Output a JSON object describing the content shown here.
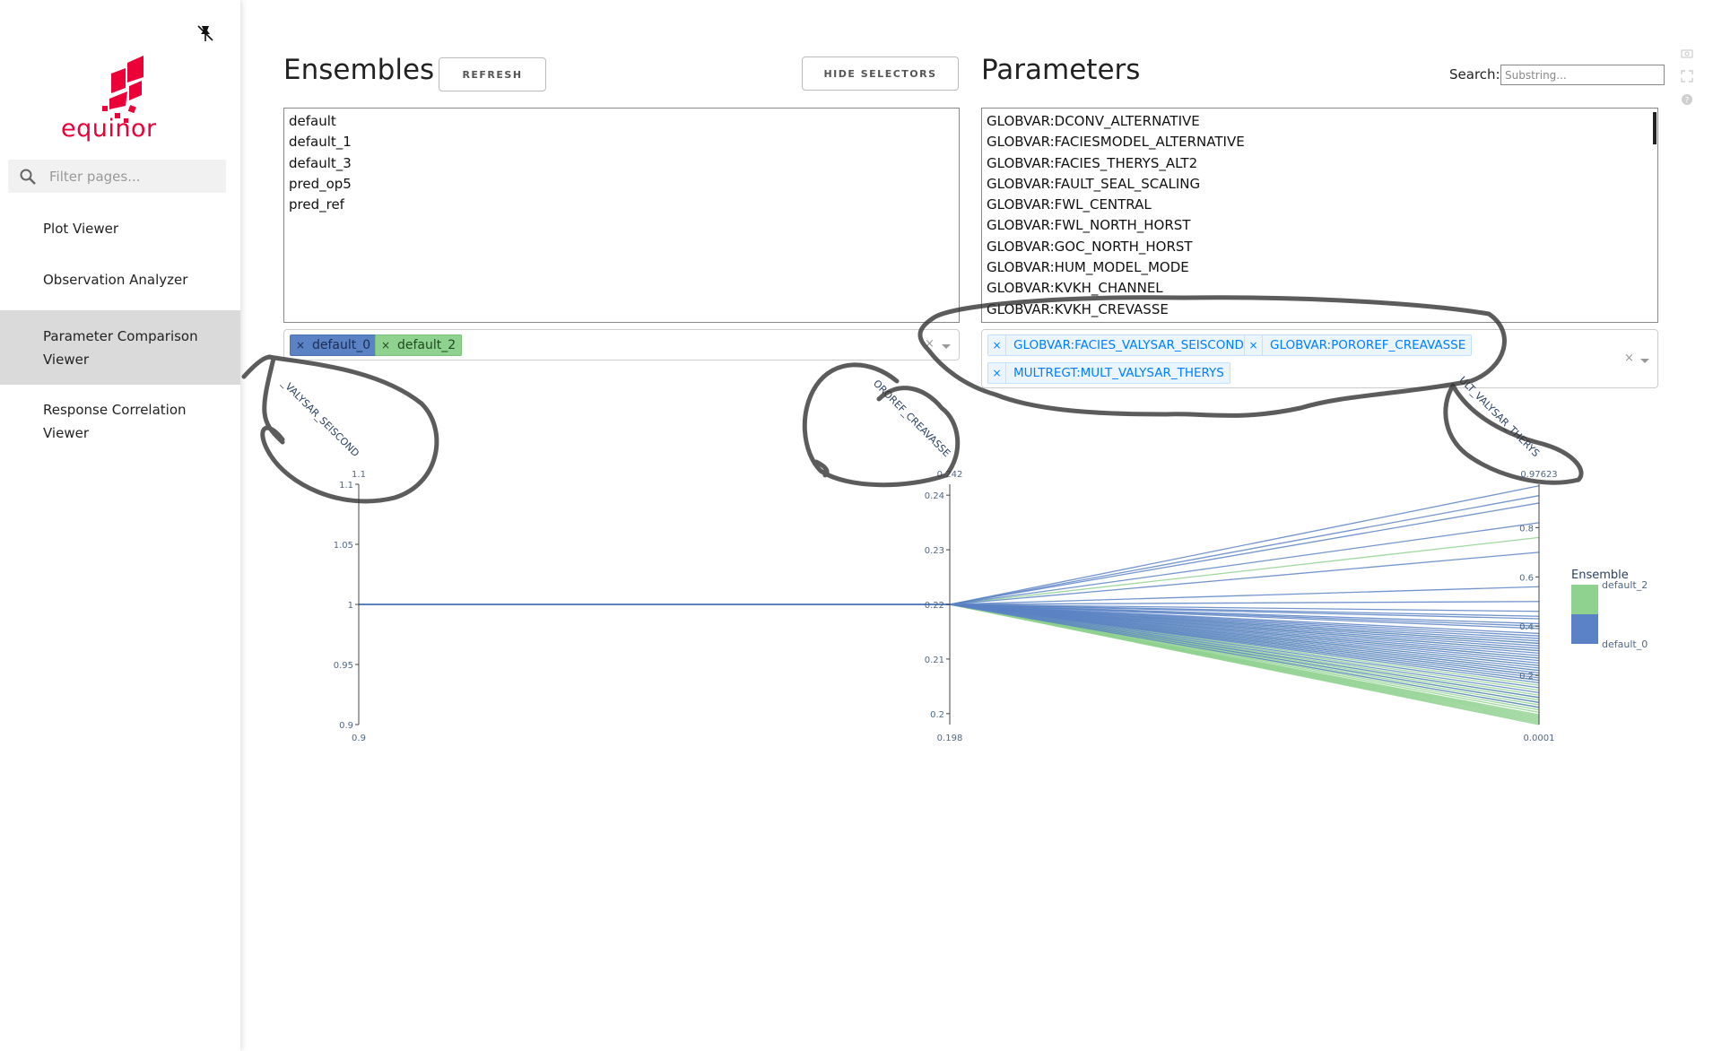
{
  "sidebar": {
    "logo_text": "equinor",
    "filter_placeholder": "Filter pages...",
    "items": [
      {
        "label": "Plot Viewer"
      },
      {
        "label": "Observation Analyzer"
      },
      {
        "label": "Parameter Comparison Viewer",
        "line1": "Parameter Comparison",
        "line2": "Viewer",
        "selected": true
      },
      {
        "label": "Response Correlation Viewer"
      }
    ]
  },
  "ensembles": {
    "title": "Ensembles",
    "refresh_label": "REFRESH",
    "hide_selectors_label": "HIDE SELECTORS",
    "options": [
      "default",
      "default_1",
      "default_3",
      "pred_op5",
      "pred_ref"
    ],
    "selected": [
      "default_0",
      "default_2"
    ],
    "clear_label": "×"
  },
  "parameters": {
    "title": "Parameters",
    "search_label": "Search:",
    "search_placeholder": "Substring...",
    "options": [
      "GLOBVAR:DCONV_ALTERNATIVE",
      "GLOBVAR:FACIESMODEL_ALTERNATIVE",
      "GLOBVAR:FACIES_THERYS_ALT2",
      "GLOBVAR:FAULT_SEAL_SCALING",
      "GLOBVAR:FWL_CENTRAL",
      "GLOBVAR:FWL_NORTH_HORST",
      "GLOBVAR:GOC_NORTH_HORST",
      "GLOBVAR:HUM_MODEL_MODE",
      "GLOBVAR:KVKH_CHANNEL",
      "GLOBVAR:KVKH_CREVASSE"
    ],
    "selected": [
      "GLOBVAR:FACIES_VALYSAR_SEISCOND",
      "GLOBVAR:POROREF_CREAVASSE",
      "MULTREGT:MULT_VALYSAR_THERYS"
    ],
    "remove_label": "×",
    "clear_label": "×"
  },
  "chart_data": {
    "type": "parallel-coordinates",
    "dimensions": [
      {
        "label": "_VALYSAR_SEISCOND",
        "range": [
          0.9,
          1.1
        ],
        "range_labels": [
          "0.9",
          "1.1"
        ],
        "ticks": [
          "0.9",
          "0.95",
          "1",
          "1.05",
          "1.1"
        ],
        "tick_values": [
          0.9,
          0.95,
          1,
          1.05,
          1.1
        ]
      },
      {
        "label": "OROREF_CREAVASSE",
        "range": [
          0.198,
          0.242
        ],
        "range_labels": [
          "0.198",
          "0.242"
        ],
        "ticks": [
          "0.2",
          "0.21",
          "0.22",
          "0.23",
          "0.24"
        ],
        "tick_values": [
          0.2,
          0.21,
          0.22,
          0.23,
          0.24
        ]
      },
      {
        "label": "ULT_VALYSAR_THERYS",
        "range": [
          0.0001,
          0.97623
        ],
        "range_labels": [
          "0.0001",
          "0.97623"
        ],
        "ticks": [
          "0.2",
          "0.4",
          "0.6",
          "0.8"
        ],
        "tick_values": [
          0.2,
          0.4,
          0.6,
          0.8
        ]
      }
    ],
    "legend": {
      "title": "Ensemble",
      "entries": [
        "default_2",
        "default_0"
      ],
      "placement": "right"
    },
    "colors": {
      "default_2": "#8fd18f",
      "default_0": "#5b82c4"
    },
    "series": [
      {
        "name": "default_0",
        "dim1": 1,
        "dim2": 0.22,
        "dim3": [
          0.97,
          0.93,
          0.9,
          0.82,
          0.7,
          0.56,
          0.5,
          0.46,
          0.44,
          0.43,
          0.41,
          0.4,
          0.39,
          0.37,
          0.36,
          0.35,
          0.34,
          0.33,
          0.32,
          0.31,
          0.3,
          0.29,
          0.28,
          0.27,
          0.26,
          0.25,
          0.24,
          0.23,
          0.22,
          0.21,
          0.2,
          0.19,
          0.18,
          0.17,
          0.15,
          0.13,
          0.11,
          0.09,
          0.07
        ]
      },
      {
        "name": "default_2",
        "dim1": 1,
        "dim2": 0.22,
        "dim3": [
          0.76,
          0.33,
          0.3,
          0.27,
          0.24,
          0.22,
          0.2,
          0.18,
          0.16,
          0.14,
          0.12,
          0.11,
          0.1,
          0.09,
          0.08,
          0.07,
          0.06,
          0.05,
          0.04,
          0.035,
          0.03,
          0.025,
          0.02,
          0.015,
          0.01,
          0.005,
          0.0001
        ]
      }
    ]
  }
}
